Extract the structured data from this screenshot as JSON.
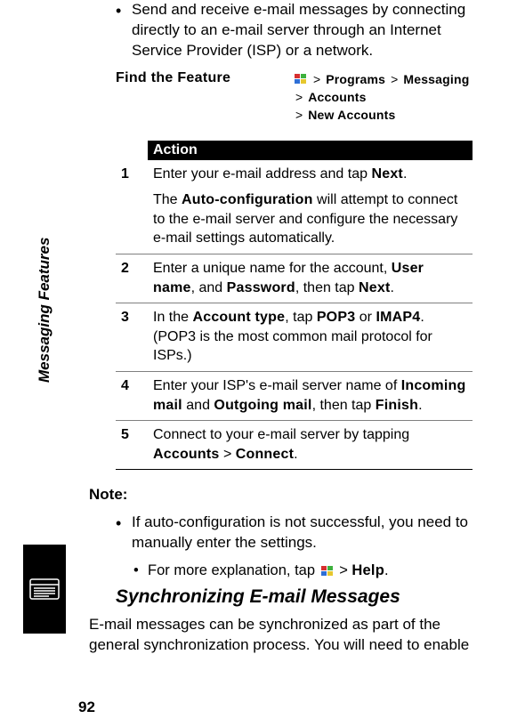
{
  "intro_bullet": "Send and receive e-mail messages by connecting directly to an e-mail server through an Internet Service Provider (ISP) or a network.",
  "feature_label": "Find the Feature",
  "nav": {
    "l1_programs": "Programs",
    "l1_messaging": "Messaging",
    "l2_accounts": "Accounts",
    "l3_new_accounts": "New Accounts"
  },
  "action_header": "Action",
  "steps": [
    {
      "num": "1",
      "pre1": "Enter your e-mail address and tap ",
      "b1": "Next",
      "post1": ".",
      "extra_pre": "The ",
      "extra_b": "Auto-configuration",
      "extra_post": " will attempt to connect to the e-mail server and configure the necessary e-mail settings automatically."
    },
    {
      "num": "2",
      "pre1": "Enter a unique name for the account, ",
      "b1": "User name",
      "mid1": ", and ",
      "b2": "Password",
      "mid2": ", then tap ",
      "b3": "Next",
      "post1": "."
    },
    {
      "num": "3",
      "pre1": "In the ",
      "b1": "Account type",
      "mid1": ", tap ",
      "b2": "POP3",
      "mid2": " or ",
      "b3": "IMAP4",
      "post1": ". (POP3 is the most common mail protocol for ISPs.)"
    },
    {
      "num": "4",
      "pre1": "Enter your ISP's e-mail server name of ",
      "b1": "Incoming mail",
      "mid1": " and ",
      "b2": "Outgoing mail",
      "mid2": ", then tap ",
      "b3": "Finish",
      "post1": "."
    },
    {
      "num": "5",
      "pre1": "Connect to your e-mail server by tapping ",
      "b1": "Accounts",
      "mid1": " > ",
      "b2": "Connect",
      "post1": "."
    }
  ],
  "note_label": "Note:",
  "note1": "If auto-configuration is not successful, you need to manually enter the settings.",
  "note2_pre": "For more explanation, tap ",
  "note2_mid": " > ",
  "note2_b": "Help",
  "note2_post": ".",
  "section_heading": "Synchronizing E-mail Messages",
  "sync_para": "E-mail messages can be synchronized as part of the general synchronization process. You will need to enable",
  "side_tab": "Messaging Features",
  "page_number": "92",
  "gt": ">"
}
